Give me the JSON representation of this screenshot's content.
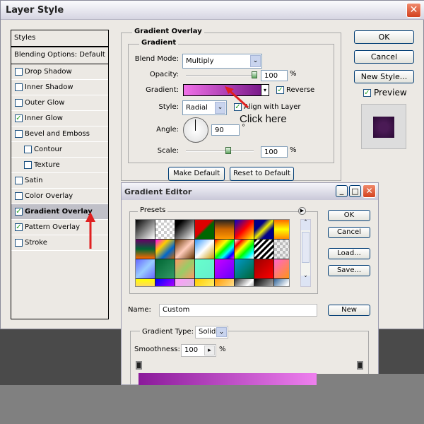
{
  "window": {
    "title": "Layer Style"
  },
  "sidebar": {
    "header": "Styles",
    "blending": "Blending Options: Default",
    "items": [
      {
        "label": "Drop Shadow",
        "checked": false,
        "indent": false
      },
      {
        "label": "Inner Shadow",
        "checked": false,
        "indent": false
      },
      {
        "label": "Outer Glow",
        "checked": false,
        "indent": false
      },
      {
        "label": "Inner Glow",
        "checked": true,
        "indent": false
      },
      {
        "label": "Bevel and Emboss",
        "checked": false,
        "indent": false
      },
      {
        "label": "Contour",
        "checked": false,
        "indent": true
      },
      {
        "label": "Texture",
        "checked": false,
        "indent": true
      },
      {
        "label": "Satin",
        "checked": false,
        "indent": false
      },
      {
        "label": "Color Overlay",
        "checked": false,
        "indent": false
      },
      {
        "label": "Gradient Overlay",
        "checked": true,
        "indent": false,
        "selected": true
      },
      {
        "label": "Pattern Overlay",
        "checked": true,
        "indent": false
      },
      {
        "label": "Stroke",
        "checked": false,
        "indent": false
      }
    ]
  },
  "overlay": {
    "group": "Gradient Overlay",
    "subgroup": "Gradient",
    "blend_label": "Blend Mode:",
    "blend_value": "Multiply",
    "opacity_label": "Opacity:",
    "opacity_value": "100",
    "opacity_pct": 100,
    "gradient_label": "Gradient:",
    "reverse_label": "Reverse",
    "reverse_checked": true,
    "style_label": "Style:",
    "style_value": "Radial",
    "align_label": "Align with Layer",
    "align_checked": true,
    "angle_label": "Angle:",
    "angle_value": "90",
    "degree": "°",
    "scale_label": "Scale:",
    "scale_value": "100",
    "scale_pct": 100,
    "percent": "%",
    "make_default": "Make Default",
    "reset_default": "Reset to Default",
    "gradient_colors": [
      "#f070e8",
      "#7a1a8a"
    ]
  },
  "annotation": {
    "text": "Click here",
    "color": "#e02020"
  },
  "buttons": {
    "ok": "OK",
    "cancel": "Cancel",
    "new_style": "New Style...",
    "preview": "Preview",
    "preview_checked": true,
    "preview_color": "#4a1a55"
  },
  "editor": {
    "title": "Gradient Editor",
    "presets": "Presets",
    "ok": "OK",
    "cancel": "Cancel",
    "load": "Load...",
    "save": "Save...",
    "name_label": "Name:",
    "name_value": "Custom",
    "new": "New",
    "type_label": "Gradient Type:",
    "type_value": "Solid",
    "smooth_label": "Smoothness:",
    "smooth_value": "100",
    "percent": "%",
    "bar_colors": [
      "#8a1a9a",
      "#ee80ee"
    ]
  }
}
